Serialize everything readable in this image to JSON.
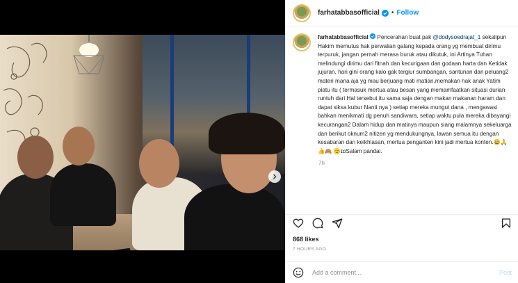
{
  "post": {
    "username": "farhatabbasofficial",
    "follow_label": "Follow",
    "separator": "•"
  },
  "caption": {
    "username": "farhatabbasofficial",
    "intro": "Pencerahan buat pak ",
    "mention": "@dodysoedrajat_1",
    "body": " sekalipun Hakim memutus hak perwalian galang kepada orang yg membuat dirimu terpuruk, jangan pernah merasa buruk atau dikutuk, ini Artinya Tuhan melindungi dirimu dari fitnah dan kecurigaan dan godaan harta dan Ketidak jujuran, hari gini orang kalo gak tergiur sumbangan, santunan dan peluang2 materi mana aja yg mau berjuang mati matian,memakan hak anak Yatim piatu itu ( termasuk mertua atau besan yang memamfaatkan situasi durian runtuh dari Hal tersebut itu sama saja dengan makan makanan haram dan dapat siksa kubur Nanti nya ) setiap mereka mungut dana , mengawasi bahkan menikmati dg penuh sandiwara, setiap waktu pula mereka dibayangi kecurangan2 Dalam hidup dan matinya maupun siang malamnya sekeluarga dan berikut oknum2 nitizen yg mendukungnya, lawan semua itu dengan kesabaran dan keikhlasan, mertua penganten kini jadi mertua konten.😀🙏👍🙈 🫡ɪɒSalam pandai.",
    "time": "7h"
  },
  "stats": {
    "likes": "868 likes",
    "posted_ago": "7 HOURS AGO"
  },
  "comment": {
    "placeholder": "Add a comment...",
    "post_label": "Post"
  },
  "icons": [
    "verified-badge-icon",
    "heart-icon",
    "comment-icon",
    "share-icon",
    "bookmark-icon",
    "emoji-icon",
    "chevron-right-icon"
  ],
  "colors": {
    "accent": "#0095f6",
    "post_disabled": "#b2dffc",
    "secondary_text": "#8e8e8e",
    "mention": "#00376b"
  }
}
